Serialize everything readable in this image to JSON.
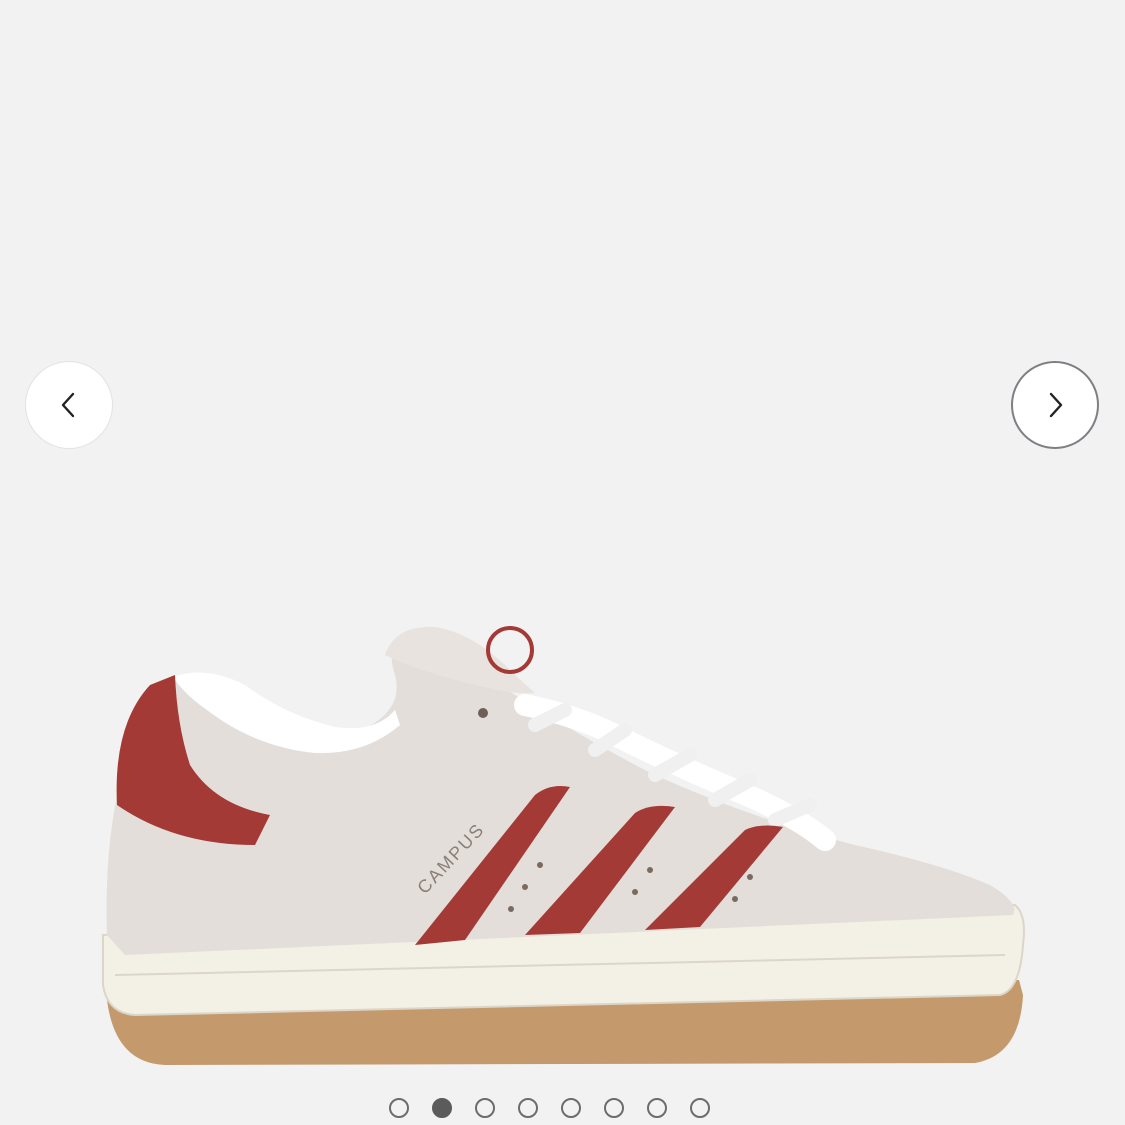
{
  "gallery": {
    "image": {
      "description": "",
      "brand_text": "CAMPUS"
    },
    "prev_icon": "chevron-left-icon",
    "next_icon": "chevron-right-icon",
    "page_count": 8,
    "active_index": 1
  },
  "colors": {
    "background": "#f2f2f2",
    "suede": "#e4deda",
    "stripe": "#a33a35",
    "sole": "#f3f0e6",
    "gum": "#c49a6c"
  }
}
